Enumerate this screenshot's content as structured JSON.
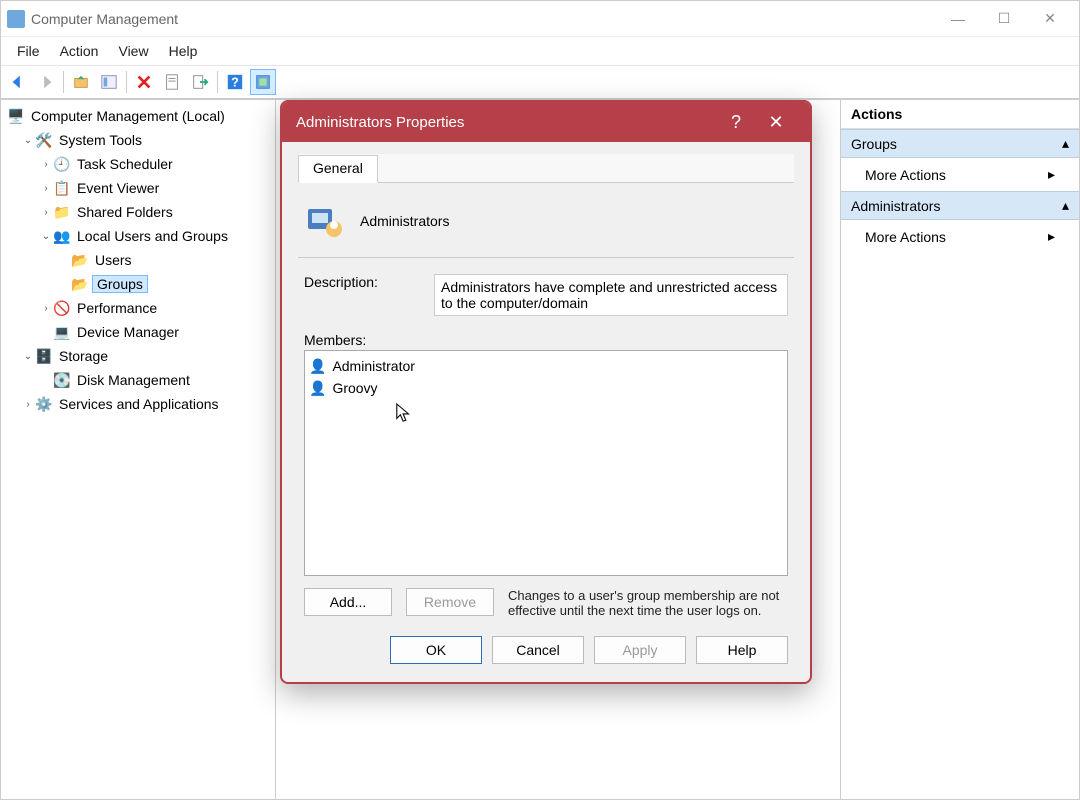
{
  "window": {
    "title": "Computer Management",
    "menus": [
      "File",
      "Action",
      "View",
      "Help"
    ]
  },
  "tree": {
    "root": "Computer Management (Local)",
    "system_tools": "System Tools",
    "task_scheduler": "Task Scheduler",
    "event_viewer": "Event Viewer",
    "shared_folders": "Shared Folders",
    "local_users_groups": "Local Users and Groups",
    "users": "Users",
    "groups": "Groups",
    "performance": "Performance",
    "device_manager": "Device Manager",
    "storage": "Storage",
    "disk_management": "Disk Management",
    "services_apps": "Services and Applications"
  },
  "actions": {
    "header": "Actions",
    "group1": "Groups",
    "more": "More Actions",
    "group2": "Administrators"
  },
  "dialog": {
    "title": "Administrators Properties",
    "tab": "General",
    "group_name": "Administrators",
    "desc_label": "Description:",
    "desc_value": "Administrators have complete and unrestricted access to the computer/domain",
    "members_label": "Members:",
    "members": [
      "Administrator",
      "Groovy"
    ],
    "add": "Add...",
    "remove": "Remove",
    "note": "Changes to a user's group membership are not effective until the next time the user logs on.",
    "ok": "OK",
    "cancel": "Cancel",
    "apply": "Apply",
    "help": "Help"
  }
}
